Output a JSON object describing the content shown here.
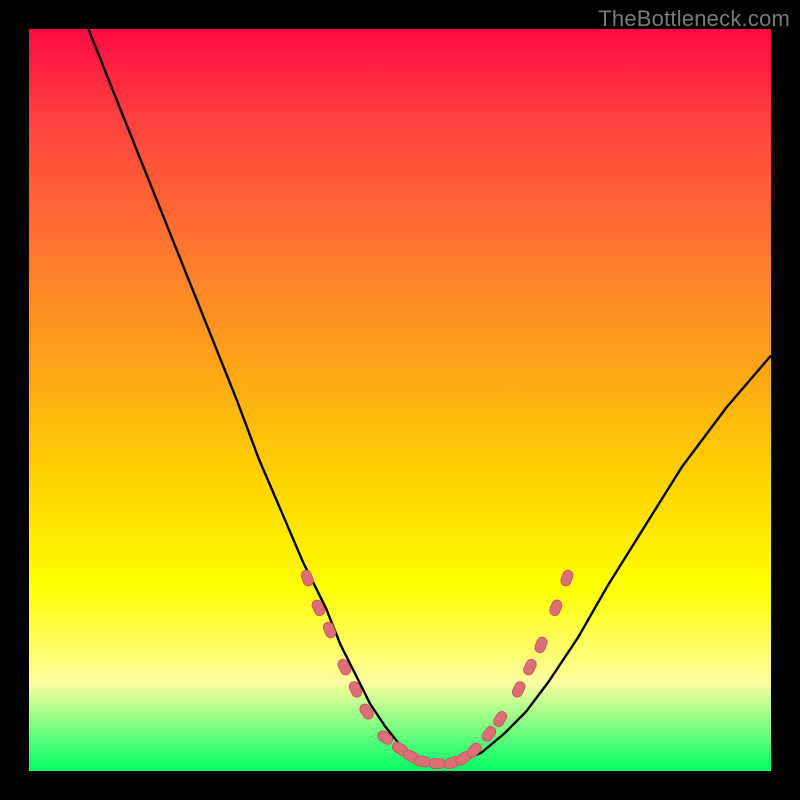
{
  "watermark": "TheBottleneck.com",
  "colors": {
    "frame": "#000000",
    "curve": "#000000",
    "marker_fill": "#dd6f77",
    "marker_stroke": "#c45a62",
    "gradient_top": "#ff0b42",
    "gradient_bottom": "#00ff66"
  },
  "chart_data": {
    "type": "line",
    "title": "",
    "xlabel": "",
    "ylabel": "",
    "xlim": [
      0,
      100
    ],
    "ylim": [
      0,
      100
    ],
    "grid": false,
    "legend": false,
    "series": [
      {
        "name": "bottleneck-curve",
        "x": [
          8,
          12,
          16,
          20,
          24,
          28,
          31,
          34,
          37,
          40,
          42,
          44,
          46,
          48,
          50,
          52,
          54,
          56,
          58,
          61,
          64,
          67,
          70,
          74,
          78,
          83,
          88,
          94,
          100
        ],
        "values": [
          100,
          90,
          80,
          70,
          60,
          50,
          42,
          35,
          28,
          22,
          17,
          13,
          9,
          6,
          3.5,
          2,
          1.2,
          1,
          1.2,
          2.5,
          5,
          8,
          12,
          18,
          25,
          33,
          41,
          49,
          56
        ]
      }
    ],
    "markers": {
      "series": "bottleneck-curve",
      "style": "pill",
      "points": [
        {
          "x": 37.5,
          "y": 26
        },
        {
          "x": 39,
          "y": 22
        },
        {
          "x": 40.5,
          "y": 19
        },
        {
          "x": 42.5,
          "y": 14
        },
        {
          "x": 44,
          "y": 11
        },
        {
          "x": 45.5,
          "y": 8
        },
        {
          "x": 48,
          "y": 4.5
        },
        {
          "x": 50,
          "y": 3
        },
        {
          "x": 51.5,
          "y": 2
        },
        {
          "x": 53,
          "y": 1.3
        },
        {
          "x": 55,
          "y": 1
        },
        {
          "x": 57,
          "y": 1.1
        },
        {
          "x": 58.5,
          "y": 1.7
        },
        {
          "x": 60,
          "y": 2.8
        },
        {
          "x": 62,
          "y": 5
        },
        {
          "x": 63.5,
          "y": 7
        },
        {
          "x": 66,
          "y": 11
        },
        {
          "x": 67.5,
          "y": 14
        },
        {
          "x": 69,
          "y": 17
        },
        {
          "x": 71,
          "y": 22
        },
        {
          "x": 72.5,
          "y": 26
        }
      ]
    }
  }
}
